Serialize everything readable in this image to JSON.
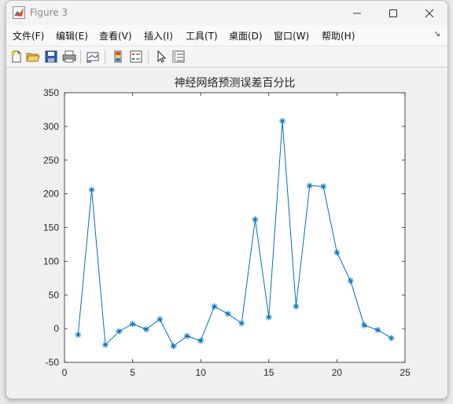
{
  "window": {
    "title": "Figure 3"
  },
  "menu": {
    "items": [
      "文件(F)",
      "编辑(E)",
      "查看(V)",
      "插入(I)",
      "工具(T)",
      "桌面(D)",
      "窗口(W)",
      "帮助(H)"
    ]
  },
  "toolbar": {
    "icons": [
      "new-figure-icon",
      "open-file-icon",
      "save-icon",
      "print-icon",
      "link-plot-icon",
      "colorbar-icon",
      "legend-icon",
      "pointer-icon",
      "property-inspector-icon"
    ]
  },
  "colors": {
    "series": "#0072bd",
    "axes_bg": "#ffffff",
    "figure_bg": "#f0f0f0"
  },
  "chart_data": {
    "type": "line",
    "title": "神经网络预测误差百分比",
    "xlabel": "",
    "ylabel": "",
    "xlim": [
      0,
      25
    ],
    "ylim": [
      -50,
      350
    ],
    "xticks": [
      0,
      5,
      10,
      15,
      20,
      25
    ],
    "yticks": [
      -50,
      0,
      50,
      100,
      150,
      200,
      250,
      300,
      350
    ],
    "marker": "asterisk",
    "grid": false,
    "series": [
      {
        "x": [
          1,
          2,
          3,
          4,
          5,
          6,
          7,
          8,
          9,
          10,
          11,
          12,
          13,
          14,
          15,
          16,
          17,
          18,
          19,
          20,
          21,
          22,
          23,
          24
        ],
        "values": [
          -9,
          206,
          -24,
          -4,
          7,
          -1,
          14,
          -26,
          -11,
          -18,
          33,
          22,
          8,
          162,
          17,
          308,
          33,
          212,
          211,
          113,
          71,
          5,
          -2,
          -14
        ]
      }
    ]
  }
}
